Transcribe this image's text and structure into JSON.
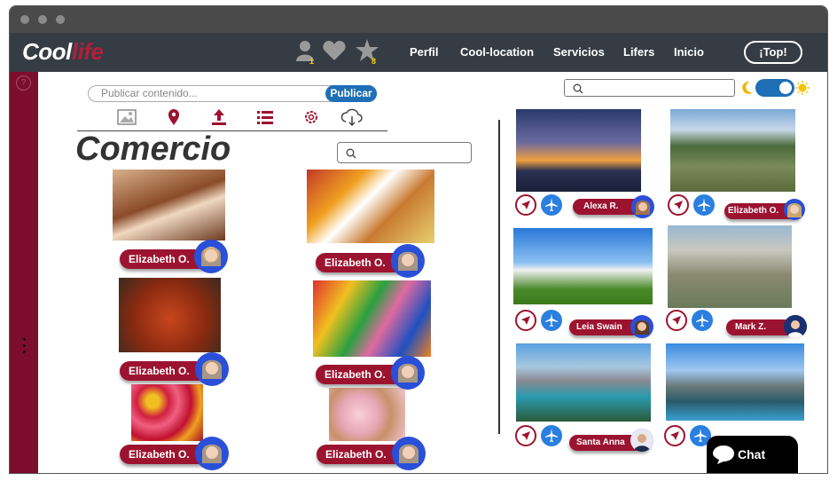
{
  "nav": {
    "logo_cool": "Cool",
    "logo_life": "life",
    "user_count": "1",
    "star_count": "8",
    "links": [
      "Perfil",
      "Cool-location",
      "Servicios",
      "Lifers",
      "Inicio"
    ],
    "top_button": "¡Top!"
  },
  "post": {
    "placeholder": "Publicar contenido...",
    "button": "Publicar"
  },
  "tools": [
    "image-icon",
    "location-pin-icon",
    "upload-icon",
    "list-icon",
    "gear-icon",
    "cloud-download-icon"
  ],
  "section_title": "Comercio",
  "commerce_posts": [
    {
      "author": "Elizabeth O.",
      "image": "donuts-photo"
    },
    {
      "author": "Elizabeth O.",
      "image": "breakfast-photo"
    },
    {
      "author": "Elizabeth O.",
      "image": "chicken-wings-photo"
    },
    {
      "author": "Elizabeth O.",
      "image": "candy-photo"
    },
    {
      "author": "Elizabeth O.",
      "image": "roses-photo"
    },
    {
      "author": "Elizabeth O.",
      "image": "donuts-sprinkles-photo"
    }
  ],
  "places": [
    {
      "author": "Alexa R.",
      "image": "sydney-bridge-photo"
    },
    {
      "author": "Elizabeth O.",
      "image": "machu-picchu-photo"
    },
    {
      "author": "Leia Swain",
      "image": "eiffel-tower-photo"
    },
    {
      "author": "Mark Z.",
      "image": "rio-christ-photo"
    },
    {
      "author": "Santa Anna",
      "image": "mountain-lake-photo"
    },
    {
      "author": "",
      "image": "mountain-city-photo"
    }
  ],
  "chat_label": "Chat",
  "colors": {
    "accent": "#9c1330",
    "brand_blue": "#1e6fb5",
    "nav_bg": "#363c44",
    "sidebar": "#7d0d2e"
  }
}
